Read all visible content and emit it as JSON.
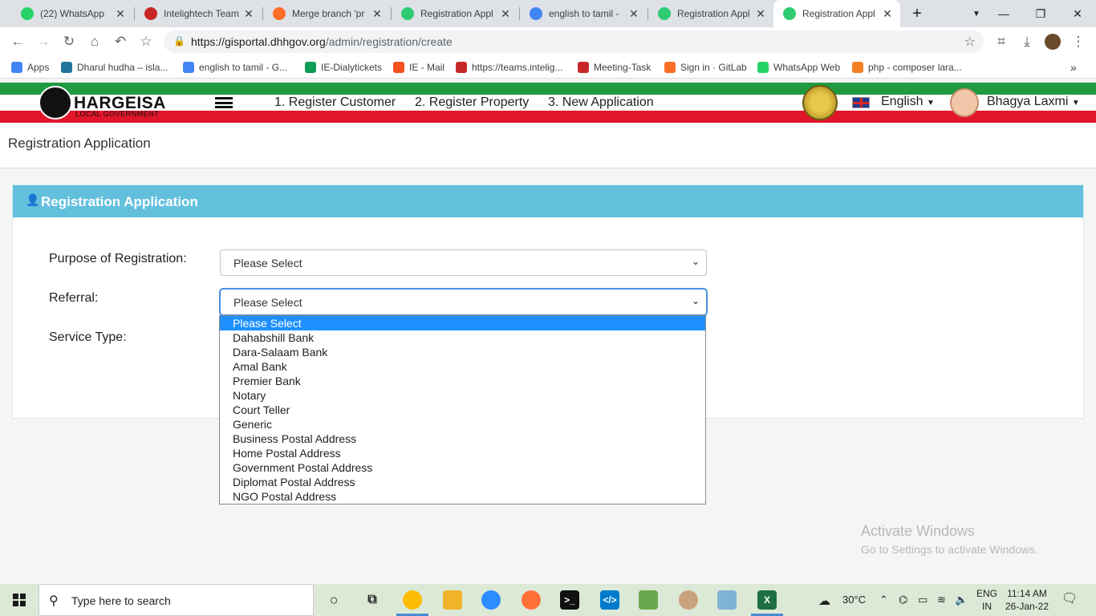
{
  "browser": {
    "tabs": [
      {
        "title": "(22) WhatsApp",
        "color": "#25d366"
      },
      {
        "title": "Intelightech Team",
        "color": "#c62828"
      },
      {
        "title": "Merge branch 'pr",
        "color": "#fc6d26"
      },
      {
        "title": "Registration Appl",
        "color": "#2ecc71"
      },
      {
        "title": "english to tamil - ",
        "color": "#4285f4"
      },
      {
        "title": "Registration Appl",
        "color": "#2ecc71"
      },
      {
        "title": "Registration Appl",
        "color": "#2ecc71"
      }
    ],
    "new_tab": "+",
    "url_host": "https://gisportal.dhhgov.org",
    "url_path": "/admin/registration/create",
    "bookmarks": [
      {
        "label": "Apps",
        "color": "#4285f4"
      },
      {
        "label": "Dharul hudha – isla...",
        "color": "#21759b"
      },
      {
        "label": "english to tamil - G...",
        "color": "#4285f4"
      },
      {
        "label": "IE-Dialytickets",
        "color": "#0f9d58"
      },
      {
        "label": "IE - Mail",
        "color": "#f4511e"
      },
      {
        "label": "https://teams.intelig...",
        "color": "#c62828"
      },
      {
        "label": "Meeting-Task",
        "color": "#c62828"
      },
      {
        "label": "Sign in · GitLab",
        "color": "#fc6d26"
      },
      {
        "label": "WhatsApp Web",
        "color": "#25d366"
      },
      {
        "label": "php - composer lara...",
        "color": "#f48024"
      }
    ]
  },
  "header": {
    "logo_text": "HARGEISA",
    "logo_sub": "LOCAL GOVERNMENT",
    "nav": [
      "1. Register Customer",
      "2. Register Property",
      "3. New Application"
    ],
    "language": "English",
    "user": "Bhagya Laxmi"
  },
  "page": {
    "title": "Registration Application",
    "panel_title": "Registration Application"
  },
  "form": {
    "purpose_label": "Purpose of Registration:",
    "purpose_value": "Please Select",
    "referral_label": "Referral:",
    "referral_value": "Please Select",
    "service_label": "Service Type:"
  },
  "dropdown_options": [
    "Please Select",
    "Dahabshill Bank",
    "Dara-Salaam Bank",
    "Amal Bank",
    "Premier Bank",
    "Notary",
    "Court Teller",
    "Generic",
    "Business Postal Address",
    "Home Postal Address",
    "Government Postal Address",
    "Diplomat Postal Address",
    "NGO Postal Address"
  ],
  "watermark": {
    "line1": "Activate Windows",
    "line2": "Go to Settings to activate Windows."
  },
  "taskbar": {
    "search_placeholder": "Type here to search",
    "temperature": "30°C",
    "lang_top": "ENG",
    "lang_bottom": "IN",
    "time": "11:14 AM",
    "date": "26-Jan-22"
  }
}
